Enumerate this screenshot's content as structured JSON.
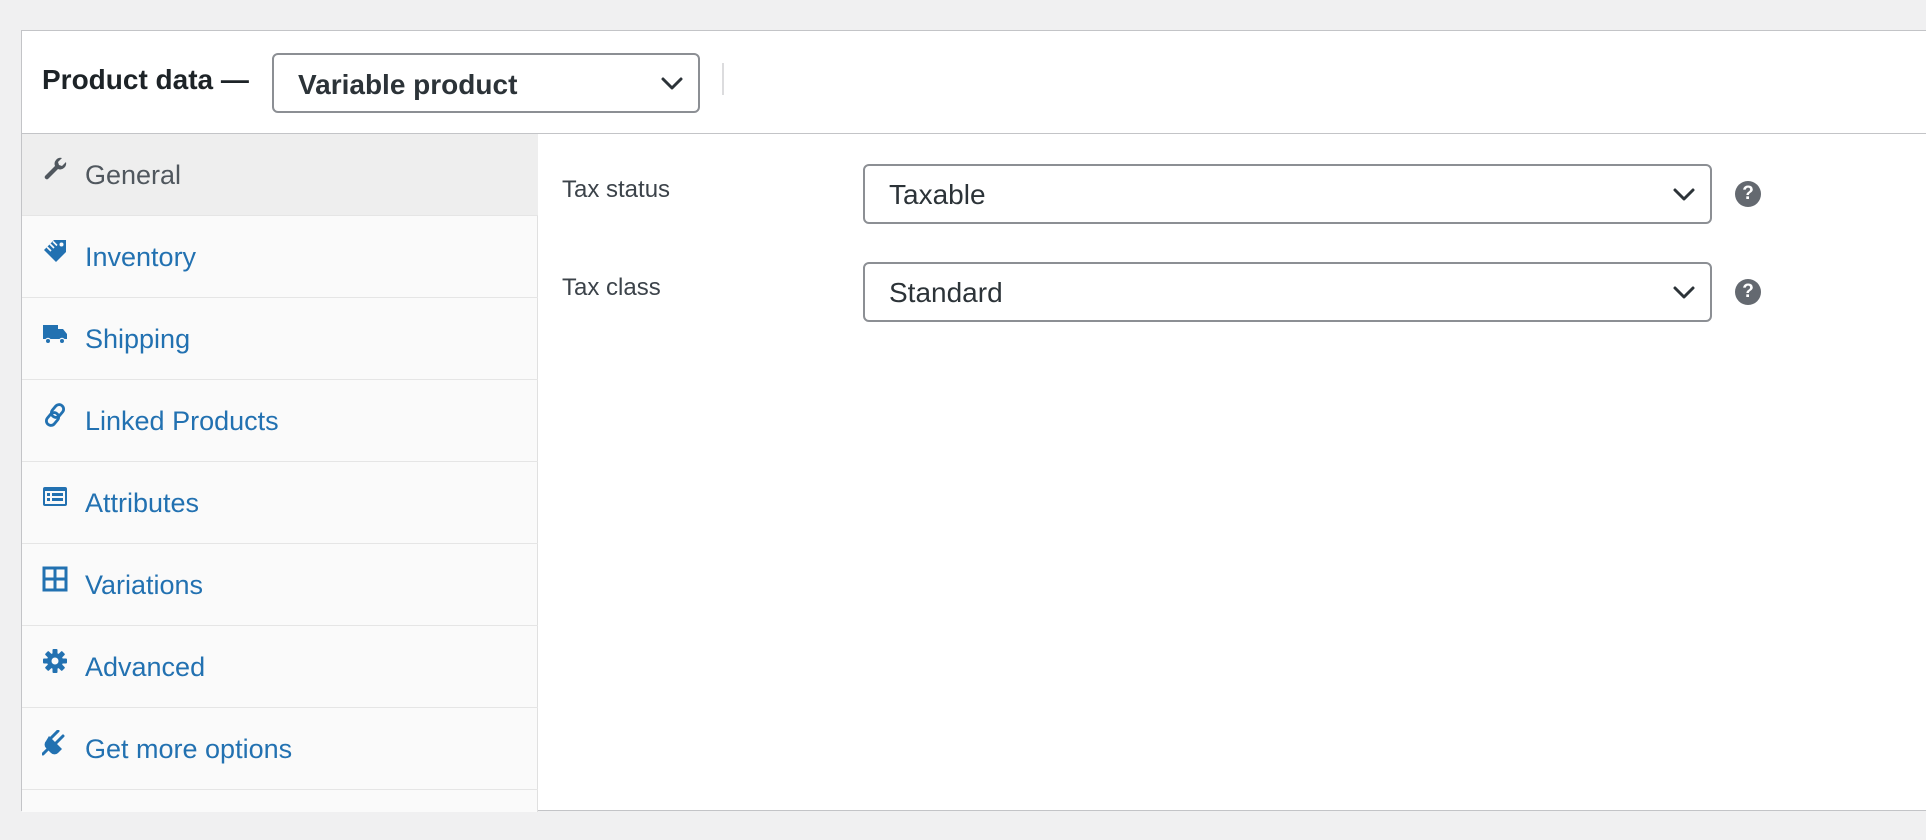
{
  "header": {
    "title": "Product data —",
    "product_type": "Variable product"
  },
  "tabs": [
    {
      "label": "General",
      "icon": "wrench-icon",
      "active": true
    },
    {
      "label": "Inventory",
      "icon": "tag-icon"
    },
    {
      "label": "Shipping",
      "icon": "truck-icon"
    },
    {
      "label": "Linked Products",
      "icon": "link-icon"
    },
    {
      "label": "Attributes",
      "icon": "list-card-icon"
    },
    {
      "label": "Variations",
      "icon": "grid-icon"
    },
    {
      "label": "Advanced",
      "icon": "gear-icon"
    },
    {
      "label": "Get more options",
      "icon": "plug-icon"
    }
  ],
  "fields": {
    "tax_status": {
      "label": "Tax status",
      "value": "Taxable"
    },
    "tax_class": {
      "label": "Tax class",
      "value": "Standard"
    }
  },
  "help_glyph": "?",
  "colors": {
    "link": "#2271b1",
    "active_tab_bg": "#eeeeee",
    "border": "#8c8f94",
    "help_bg": "#646970"
  }
}
